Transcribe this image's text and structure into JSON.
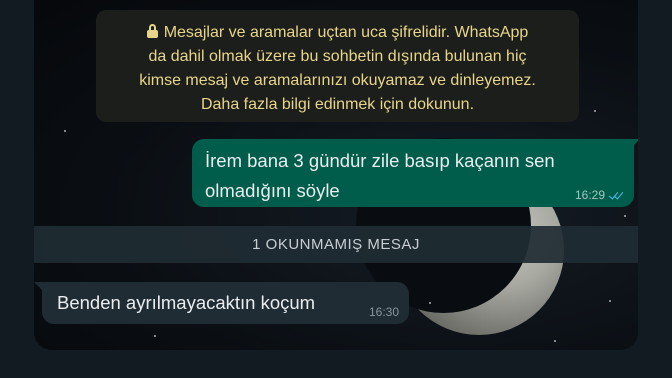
{
  "encryption_notice": {
    "line1": "Mesajlar ve aramalar uçtan uca şifrelidir. WhatsApp",
    "line2": "da dahil olmak üzere bu sohbetin dışında bulunan hiç",
    "line3": "kimse mesaj ve aramalarınızı okuyamaz ve dinleyemez.",
    "line4": "Daha fazla bilgi edinmek için dokunun.",
    "icon": "lock-icon"
  },
  "messages": [
    {
      "direction": "outgoing",
      "line1": "İrem bana 3 gündür zile basıp kaçanın sen",
      "line2": "olmadığını söyle",
      "time": "16:29",
      "status_icon": "read-ticks-icon"
    },
    {
      "direction": "incoming",
      "text": "Benden ayrılmayacaktın koçum",
      "time": "16:30"
    }
  ],
  "unread_banner": "1 OKUNMAMIŞ MESAJ",
  "colors": {
    "background": "#121b22",
    "outgoing_bubble": "#005c4b",
    "incoming_bubble": "#202c33",
    "notice_text": "#e9d58a",
    "read_ticks": "#53bdeb"
  }
}
